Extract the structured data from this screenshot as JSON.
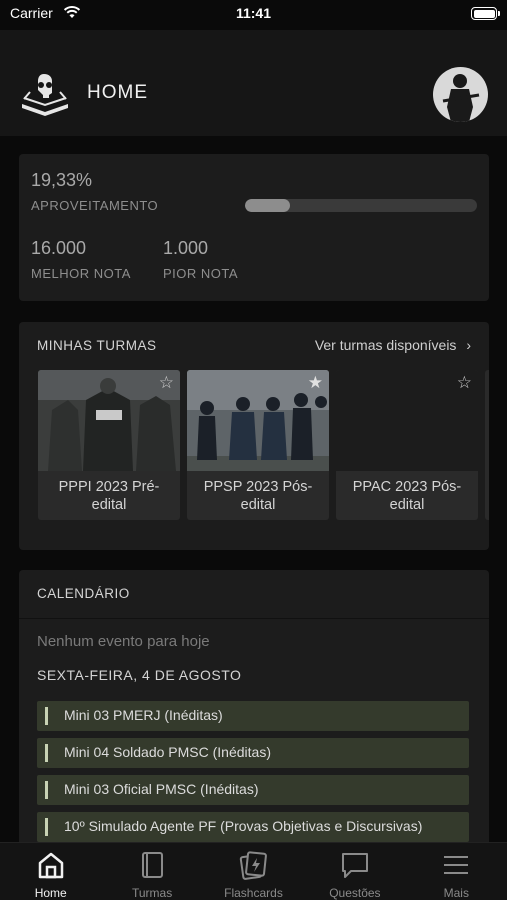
{
  "status_bar": {
    "carrier": "Carrier",
    "time": "11:41"
  },
  "header": {
    "title": "HOME"
  },
  "stats": {
    "aproveitamento_value": "19,33%",
    "aproveitamento_label": "APROVEITAMENTO",
    "progress_fraction": 0.1933,
    "melhor_nota_value": "16.000",
    "melhor_nota_label": "MELHOR NOTA",
    "pior_nota_value": "1.000",
    "pior_nota_label": "PIOR NOTA"
  },
  "turmas": {
    "title": "MINHAS TURMAS",
    "see_all": "Ver turmas disponíveis",
    "courses": [
      {
        "name": "PPPI 2023 Pré-edital",
        "starred": false
      },
      {
        "name": "PPSP 2023 Pós-edital",
        "starred": true
      },
      {
        "name": "PPAC 2023 Pós-edital",
        "starred": false
      }
    ]
  },
  "calendar": {
    "title": "CALENDÁRIO",
    "no_events": "Nenhum evento para hoje",
    "day_label": "SEXTA-FEIRA, 4 DE AGOSTO",
    "events": [
      "Mini 03 PMERJ (Inéditas)",
      "Mini 04 Soldado PMSC (Inéditas)",
      "Mini 03 Oficial PMSC (Inéditas)",
      "10º Simulado Agente PF (Provas Objetivas e Discursivas)"
    ]
  },
  "tabbar": {
    "tabs": [
      {
        "label": "Home",
        "icon": "home-icon",
        "active": true
      },
      {
        "label": "Turmas",
        "icon": "book-icon",
        "active": false
      },
      {
        "label": "Flashcards",
        "icon": "flashcards-icon",
        "active": false
      },
      {
        "label": "Questões",
        "icon": "chat-icon",
        "active": false
      },
      {
        "label": "Mais",
        "icon": "menu-icon",
        "active": false
      }
    ]
  },
  "colors": {
    "background": "#0a0a0a",
    "card": "#1c1c1c",
    "event_bg": "#343a2c",
    "accent": "#c8d2b4"
  }
}
